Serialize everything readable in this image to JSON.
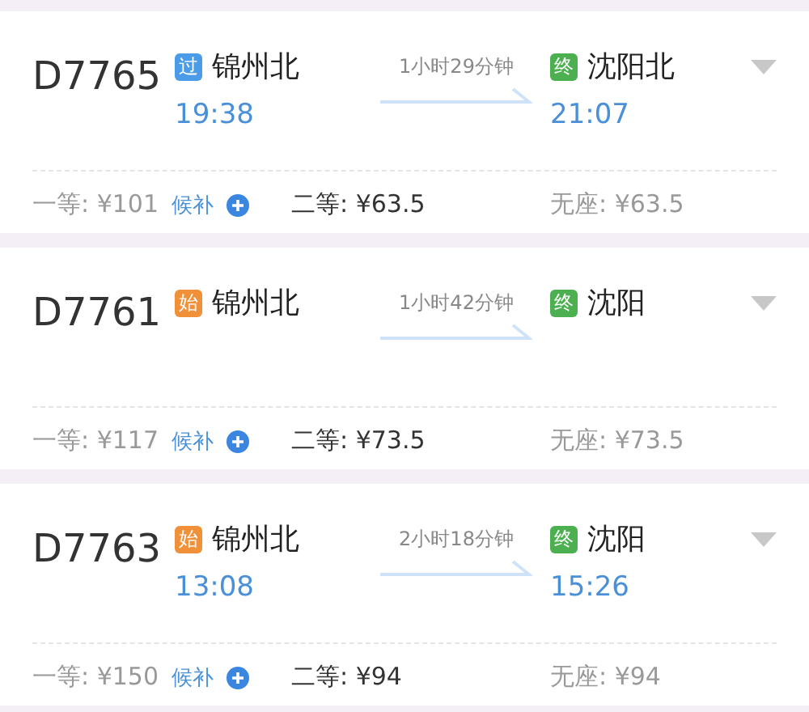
{
  "trains": [
    {
      "number": "D7765",
      "from": {
        "badge": "过",
        "kind": "pass",
        "name": "锦州北",
        "time": "19:38"
      },
      "duration": "1小时29分钟",
      "to": {
        "badge": "终",
        "kind": "end",
        "name": "沈阳北",
        "time": "21:07"
      },
      "seats": [
        {
          "label": "一等: ¥101",
          "available": false,
          "waitlist": "候补"
        },
        {
          "label": "二等: ¥63.5",
          "available": true
        },
        {
          "label": "无座: ¥63.5",
          "available": false
        }
      ]
    },
    {
      "number": "D7761",
      "from": {
        "badge": "始",
        "kind": "start",
        "name": "锦州北"
      },
      "duration": "1小时42分钟",
      "to": {
        "badge": "终",
        "kind": "end",
        "name": "沈阳"
      },
      "seats": [
        {
          "label": "一等: ¥117",
          "available": false,
          "waitlist": "候补"
        },
        {
          "label": "二等: ¥73.5",
          "available": true
        },
        {
          "label": "无座: ¥73.5",
          "available": false
        }
      ]
    },
    {
      "number": "D7763",
      "from": {
        "badge": "始",
        "kind": "start",
        "name": "锦州北",
        "time": "13:08"
      },
      "duration": "2小时18分钟",
      "to": {
        "badge": "终",
        "kind": "end",
        "name": "沈阳",
        "time": "15:26"
      },
      "seats": [
        {
          "label": "一等: ¥150",
          "available": false,
          "waitlist": "候补"
        },
        {
          "label": "二等: ¥94",
          "available": true
        },
        {
          "label": "无座: ¥94",
          "available": false
        }
      ]
    }
  ]
}
